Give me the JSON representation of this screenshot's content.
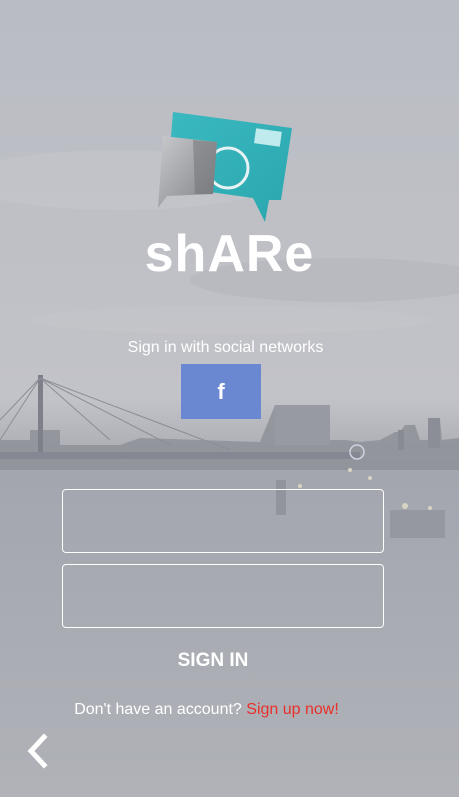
{
  "app": {
    "title": "shARe"
  },
  "social": {
    "label": "Sign in with social networks",
    "facebook_glyph": "f",
    "facebook_color": "#6a87d2"
  },
  "form": {
    "username_value": "",
    "username_placeholder": "",
    "password_value": "",
    "password_placeholder": "",
    "signin_label": "SIGN IN"
  },
  "footer": {
    "prompt": "Don't have an account?",
    "signup_label": "Sign up now!",
    "signup_color": "#e8302a"
  },
  "icons": {
    "back": "chevron-left-icon",
    "logo": "share-logo-icon",
    "facebook": "facebook-icon"
  }
}
